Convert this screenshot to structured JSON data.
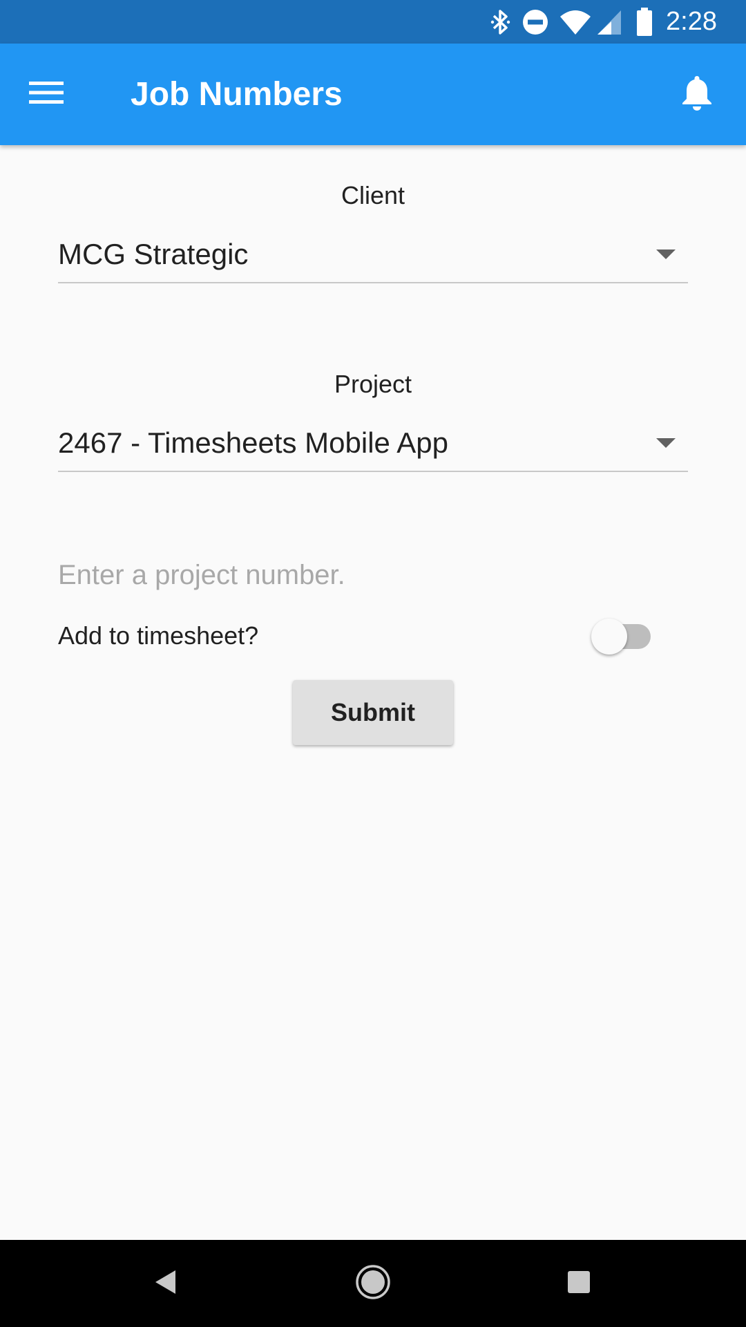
{
  "status_bar": {
    "time": "2:28",
    "icons": [
      "bluetooth-icon",
      "do-not-disturb-icon",
      "wifi-icon",
      "cell-signal-icon",
      "battery-icon"
    ]
  },
  "app_bar": {
    "title": "Job Numbers",
    "menu_icon": "hamburger-menu-icon",
    "notification_icon": "bell-icon",
    "background_color": "#2196f3"
  },
  "form": {
    "client": {
      "label": "Client",
      "selected": "MCG Strategic"
    },
    "project": {
      "label": "Project",
      "selected": "2467 - Timesheets Mobile App"
    },
    "project_number": {
      "value": "",
      "placeholder": "Enter a project number."
    },
    "add_to_timesheet": {
      "label": "Add to timesheet?",
      "checked": false
    },
    "submit_label": "Submit"
  },
  "nav_bar": {
    "buttons": [
      "back-icon",
      "home-icon",
      "recents-icon"
    ]
  }
}
